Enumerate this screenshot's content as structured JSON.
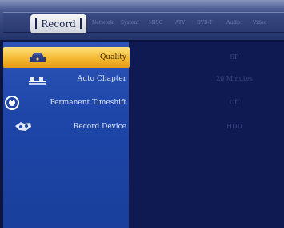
{
  "tabs": {
    "active": "Record",
    "items": [
      "Network",
      "System",
      "MISC",
      "ATV",
      "DVB-T",
      "Audio",
      "Video"
    ]
  },
  "settings": [
    {
      "label": "Quality",
      "value": "SP",
      "icon": "record-quality-icon"
    },
    {
      "label": "Auto Chapter",
      "value": "20 Minutes",
      "icon": "chapter-icon"
    },
    {
      "label": "Permanent Timeshift",
      "value": "Off",
      "icon": "timeshift-icon"
    },
    {
      "label": "Record Device",
      "value": "HDD",
      "icon": "record-device-icon"
    }
  ],
  "colors": {
    "highlight": "#f3b62e",
    "sidebar": "#1d46a8",
    "content": "#101a52"
  }
}
